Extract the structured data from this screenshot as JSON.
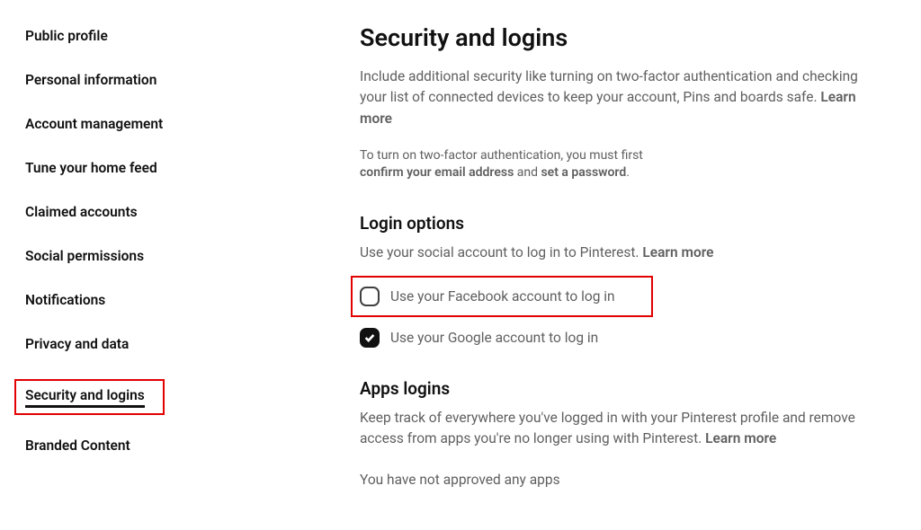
{
  "sidebar": {
    "items": [
      {
        "label": "Public profile"
      },
      {
        "label": "Personal information"
      },
      {
        "label": "Account management"
      },
      {
        "label": "Tune your home feed"
      },
      {
        "label": "Claimed accounts"
      },
      {
        "label": "Social permissions"
      },
      {
        "label": "Notifications"
      },
      {
        "label": "Privacy and data"
      },
      {
        "label": "Security and logins"
      },
      {
        "label": "Branded Content"
      }
    ]
  },
  "page": {
    "title": "Security and logins",
    "intro": "Include additional security like turning on two-factor authentication and checking your list of connected devices to keep your account, Pins and boards safe. ",
    "learn_more": "Learn more",
    "note_prefix": "To turn on two-factor authentication, you must first",
    "note_confirm": "confirm your email address",
    "note_and": " and ",
    "note_set": "set a password",
    "note_suffix": "."
  },
  "login_options": {
    "title": "Login options",
    "desc": "Use your social account to log in to Pinterest. ",
    "learn_more": "Learn more",
    "facebook_label": "Use your Facebook account to log in",
    "google_label": "Use your Google account to log in"
  },
  "apps_logins": {
    "title": "Apps logins",
    "desc": "Keep track of everywhere you've logged in with your Pinterest profile and remove access from apps you're no longer using with Pinterest. ",
    "learn_more": "Learn more",
    "empty": "You have not approved any apps"
  }
}
